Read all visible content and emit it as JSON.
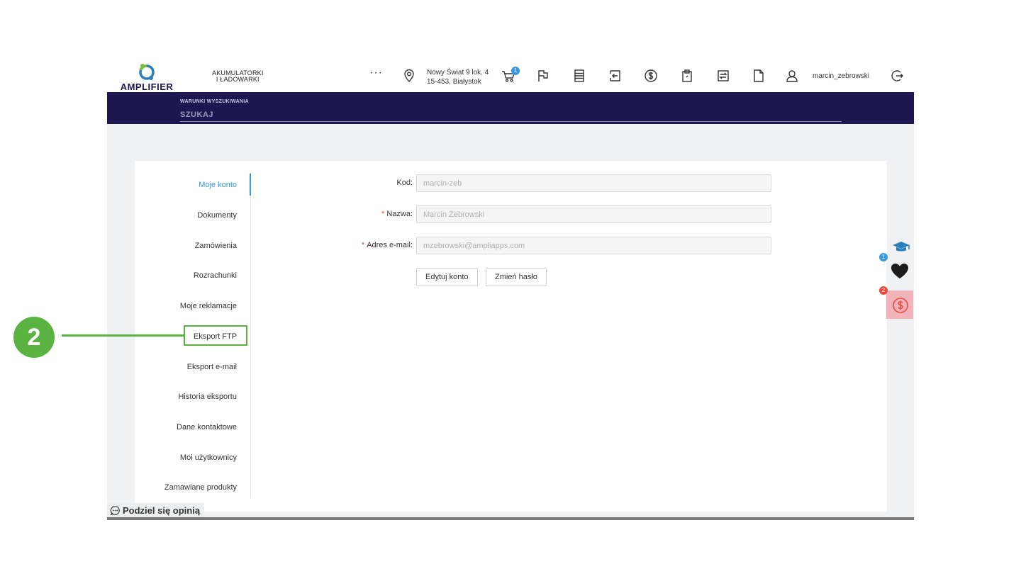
{
  "header": {
    "brand_line1": "AKUMULATORKI",
    "brand_line2": "I ŁADOWARKI",
    "more": "···",
    "address_line1": "Nowy Świat 9 lok. 4",
    "address_line2": "15-453, Białystok",
    "cart_count": "1",
    "username": "marcin_zebrowski",
    "icons": [
      "location-icon",
      "cart-icon",
      "flag-icon",
      "list-icon",
      "login-icon",
      "dollar-icon",
      "clipboard-icon",
      "exchange-icon",
      "document-icon",
      "user-icon",
      "logout-icon"
    ]
  },
  "search": {
    "label": "WARUNKI WYSZUKIWANIA",
    "placeholder": "SZUKAJ"
  },
  "sidebar": {
    "items": [
      {
        "label": "Moje konto",
        "active": true
      },
      {
        "label": "Dokumenty"
      },
      {
        "label": "Zamówienia"
      },
      {
        "label": "Rozrachunki"
      },
      {
        "label": "Moje reklamacje"
      },
      {
        "label": "Eksport FTP"
      },
      {
        "label": "Eksport e-mail"
      },
      {
        "label": "Historia eksportu"
      },
      {
        "label": "Dane kontaktowe"
      },
      {
        "label": "Moi użytkownicy"
      },
      {
        "label": "Zamawiane produkty"
      }
    ]
  },
  "form": {
    "code_label": "Kod",
    "code_value": "marcin-zeb",
    "name_label": "Nazwa",
    "name_value": "Marcin Żebrowski",
    "email_label": "Adres e-mail",
    "email_value": "mzebrowski@ampliapps.com",
    "edit_button": "Edytuj konto",
    "password_button": "Zmień hasło",
    "required_mark": "*",
    "colon": ":"
  },
  "floating": {
    "favorites_count": "1",
    "prices_count": "2"
  },
  "feedback": {
    "label": "Podziel się opinią"
  },
  "annotation": {
    "step_number": "2"
  },
  "colors": {
    "accent": "#3a9ad9",
    "navbar": "#1e1650",
    "annotation": "#5ab340",
    "danger": "#e74c3c"
  }
}
